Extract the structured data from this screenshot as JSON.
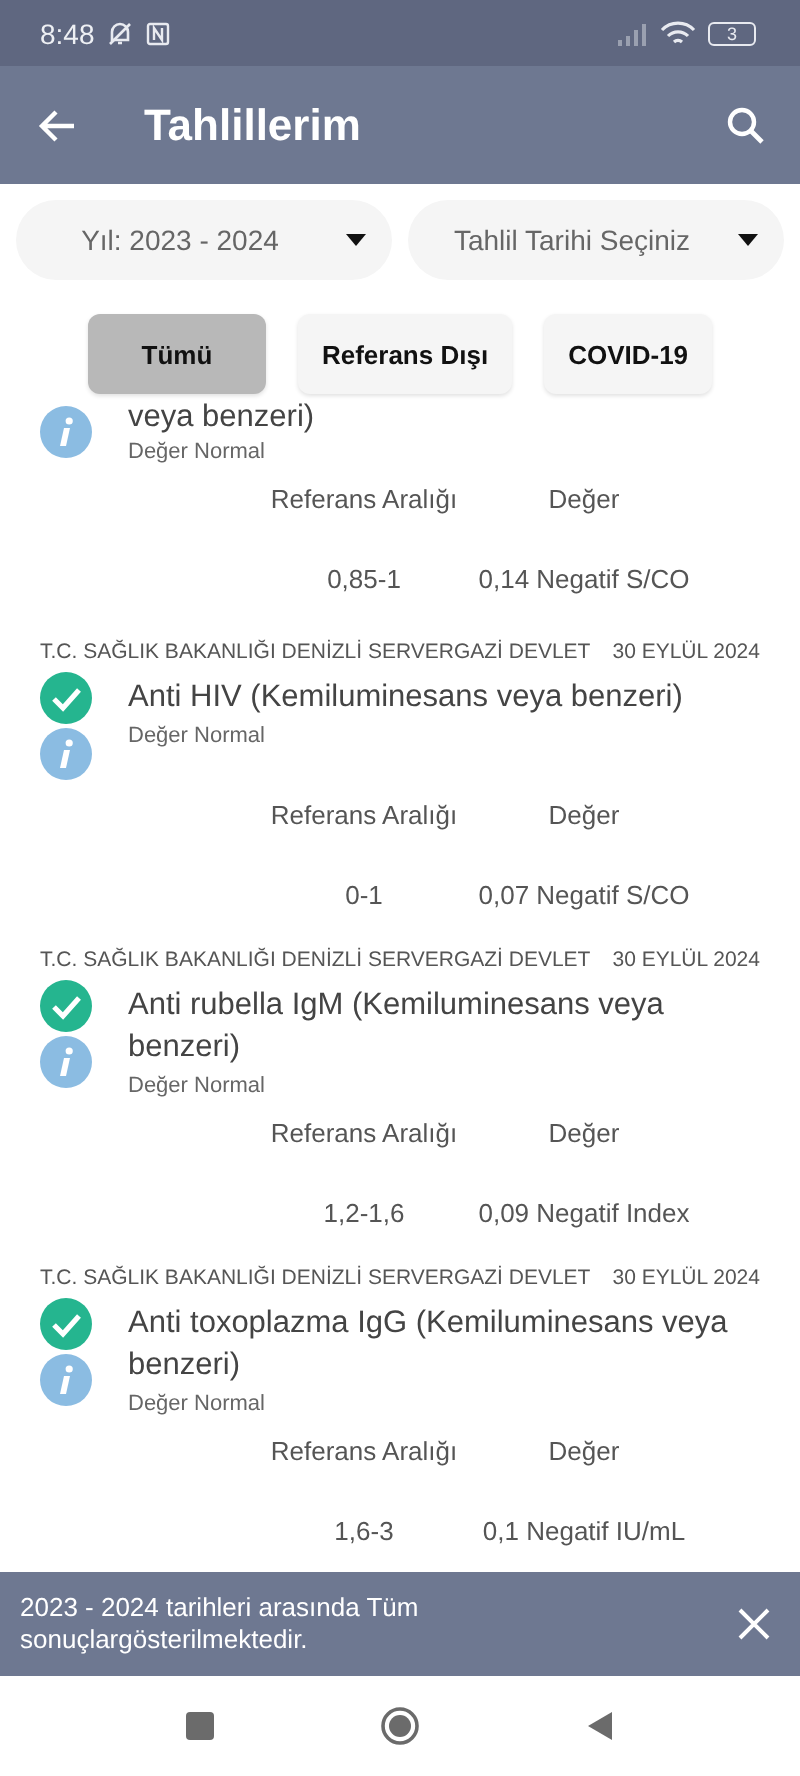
{
  "status_bar": {
    "time": "8:48",
    "battery": "3"
  },
  "app_bar": {
    "title": "Tahlillerim"
  },
  "filters": [
    {
      "value": "Yıl: 2023 - 2024"
    },
    {
      "value": "Tahlil Tarihi Seçiniz"
    }
  ],
  "chips": [
    {
      "label": "Tümü",
      "selected": true
    },
    {
      "label": "Referans Dışı",
      "selected": false
    },
    {
      "label": "COVID-19",
      "selected": false
    }
  ],
  "results": [
    {
      "kind": "partial",
      "title": "veya benzeri)",
      "status": "Değer Normal",
      "range_label": "Referans Aralığı",
      "value_label": "Değer",
      "range": "0,85-1",
      "value": "0,14 Negatif S/CO"
    },
    {
      "kind": "full",
      "institution": "T.C. SAĞLIK BAKANLIĞI DENİZLİ SERVERGAZİ DEVLET",
      "date": "30 EYLÜL 2024",
      "title": "Anti HIV (Kemiluminesans veya benzeri)",
      "normal": true,
      "status": "Değer Normal",
      "range_label": "Referans Aralığı",
      "value_label": "Değer",
      "range": "0-1",
      "value": "0,07 Negatif S/CO"
    },
    {
      "kind": "full",
      "institution": "T.C. SAĞLIK BAKANLIĞI DENİZLİ SERVERGAZİ DEVLET",
      "date": "30 EYLÜL 2024",
      "title": "Anti rubella IgM (Kemiluminesans veya benzeri)",
      "normal": true,
      "status": "Değer Normal",
      "range_label": "Referans Aralığı",
      "value_label": "Değer",
      "range": "1,2-1,6",
      "value": "0,09 Negatif Index"
    },
    {
      "kind": "full",
      "institution": "T.C. SAĞLIK BAKANLIĞI DENİZLİ SERVERGAZİ DEVLET",
      "date": "30 EYLÜL 2024",
      "title": "Anti toxoplazma IgG (Kemiluminesans veya benzeri)",
      "normal": true,
      "status": "Değer Normal",
      "range_label": "Referans Aralığı",
      "value_label": "Değer",
      "range": "1,6-3",
      "value": "0,1 Negatif IU/mL"
    }
  ],
  "snackbar": {
    "message": "2023 - 2024 tarihleri arasında Tüm sonuçlargösterilmektedir."
  }
}
